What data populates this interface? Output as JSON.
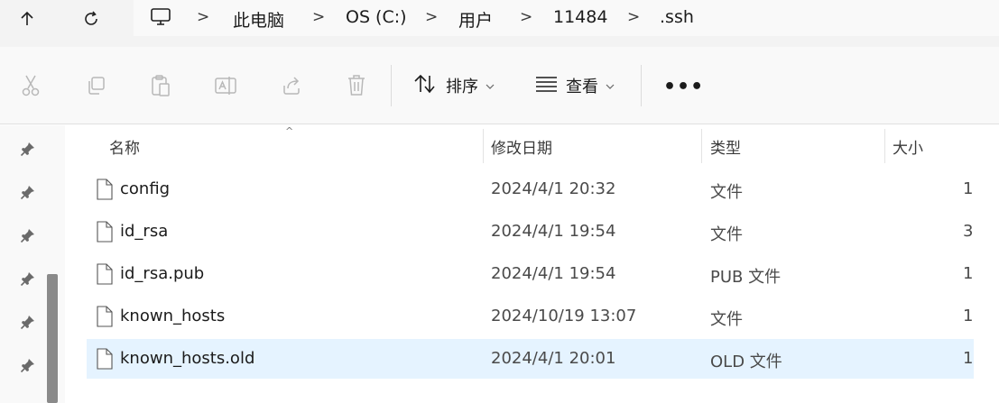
{
  "address_bar": {
    "up_icon": "arrow-up-icon",
    "refresh_icon": "refresh-icon",
    "root_icon": "computer-icon",
    "path": [
      "此电脑",
      "OS (C:)",
      "用户",
      "11484",
      ".ssh"
    ],
    "separator": ">"
  },
  "command_bar": {
    "icons": [
      "cut-icon",
      "copy-icon",
      "paste-icon",
      "rename-icon",
      "share-icon",
      "delete-icon"
    ],
    "sort_label": "排序",
    "view_label": "查看",
    "more_label": "•••"
  },
  "nav_pane": {
    "pins": [
      "pin-icon",
      "pin-icon",
      "pin-icon",
      "pin-icon",
      "pin-icon",
      "pin-icon"
    ]
  },
  "file_list": {
    "columns": {
      "name": "名称",
      "modified": "修改日期",
      "type": "类型",
      "size": "大小"
    },
    "sort_indicator": "^",
    "rows": [
      {
        "name": "config",
        "modified": "2024/4/1 20:32",
        "type": "文件",
        "size": "1"
      },
      {
        "name": "id_rsa",
        "modified": "2024/4/1 19:54",
        "type": "文件",
        "size": "3"
      },
      {
        "name": "id_rsa.pub",
        "modified": "2024/4/1 19:54",
        "type": "PUB 文件",
        "size": "1"
      },
      {
        "name": "known_hosts",
        "modified": "2024/10/19 13:07",
        "type": "文件",
        "size": "1"
      },
      {
        "name": "known_hosts.old",
        "modified": "2024/4/1 20:01",
        "type": "OLD 文件",
        "size": "1",
        "selected": true
      }
    ]
  },
  "colors": {
    "selection": "#e5f3ff",
    "toolbar_bg": "#f9f9f9",
    "address_bg": "#f3f3f3"
  }
}
